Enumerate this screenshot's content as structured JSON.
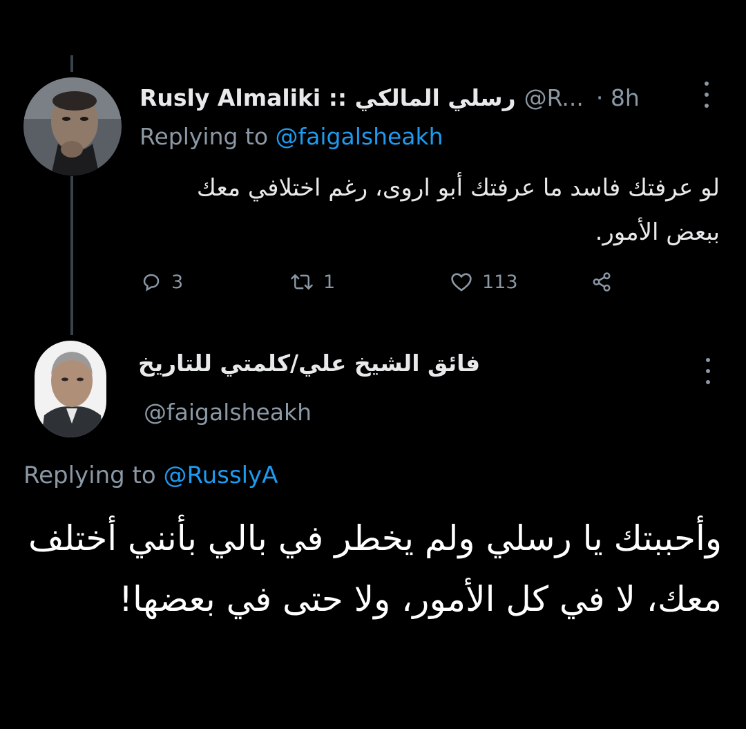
{
  "reply_tweet": {
    "display_name": "Rusly Almaliki :: رسلي المالكي",
    "handle": "@R...",
    "time": "· 8h",
    "replying_label": "Replying to",
    "replying_to": "@faigalsheakh",
    "text": "لو عرفتك فاسد ما عرفتك أبو اروى، رغم اختلافي معك ببعض الأمور.",
    "actions": {
      "replies": "3",
      "retweets": "1",
      "likes": "113"
    }
  },
  "main_tweet": {
    "display_name": "فائق الشيخ علي/كلمتي للتاريخ",
    "handle": "@faigalsheakh",
    "replying_label": "Replying to",
    "replying_to": "@RusslyA",
    "text": "وأحببتك يا رسلي ولم يخطر في بالي بأنني أختلف معك، لا في كل الأمور، ولا حتى في بعضها!"
  },
  "colors": {
    "background": "#000000",
    "secondary_text": "#8b98a5",
    "link": "#1d9bf0",
    "thread_line": "#38444d"
  },
  "icons": [
    "reply-icon",
    "retweet-icon",
    "like-icon",
    "share-icon",
    "more-options-icon"
  ]
}
